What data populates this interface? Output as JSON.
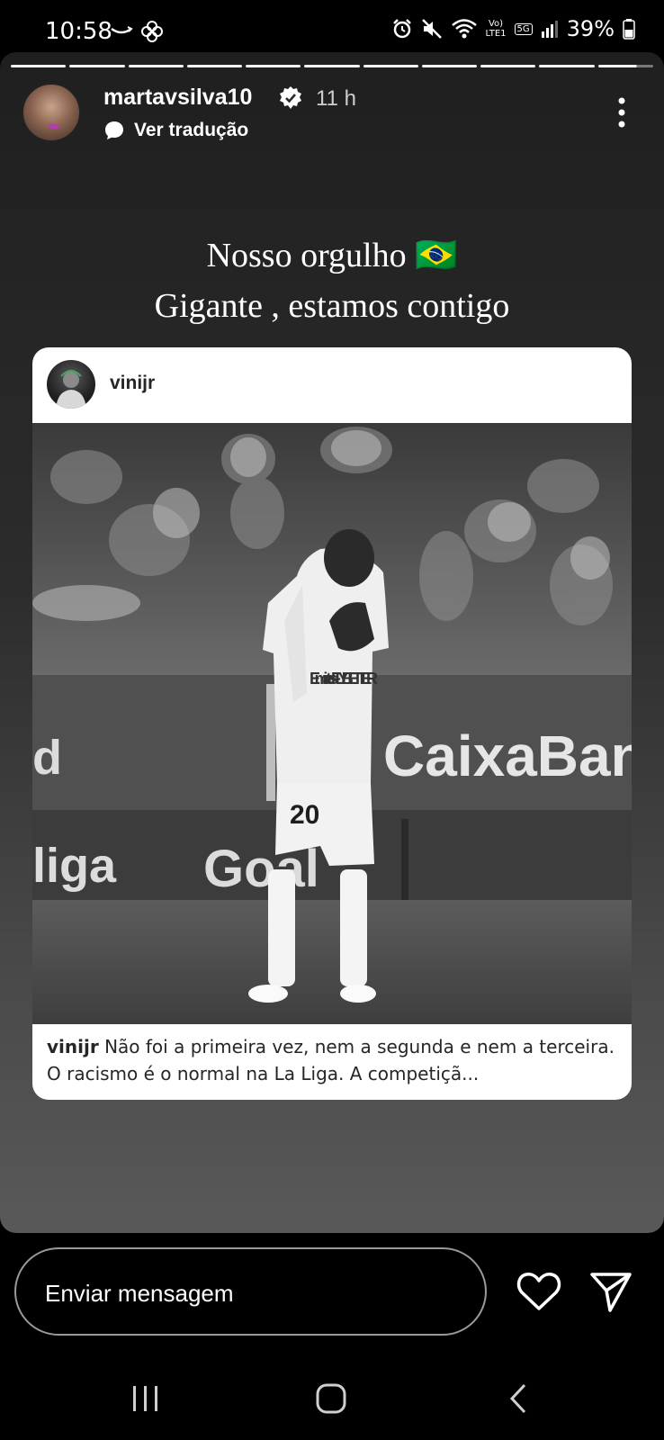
{
  "status_bar": {
    "time": "10:58",
    "network_top": "Vo)",
    "network_bottom": "LTE1",
    "net_5g": "5G",
    "battery": "39%"
  },
  "story": {
    "segments_total": 11,
    "username": "martavsilva10",
    "time_ago": "11 h",
    "translate_label": "Ver tradução",
    "headline_line1": "Nosso orgulho 🇧🇷",
    "headline_line2": "Gigante , estamos contigo"
  },
  "shared_post": {
    "username": "vinijr",
    "caption_user": "vinijr",
    "caption_text": " Não foi a primeira vez, nem a segunda e nem a terceira. O racismo é o normal na La Liga.  A competiçã...",
    "photo_texts": {
      "sponsor": "CaixaBank",
      "shirt_sponsor": "Emirates FLY BETTER",
      "number": "20",
      "board_left": "liga",
      "board_mid": "Goal"
    }
  },
  "reply_bar": {
    "placeholder": "Enviar mensagem"
  },
  "icons": [
    "silent-icon",
    "alarm-icon",
    "mute-icon",
    "wifi-icon",
    "signal-icon",
    "battery-icon",
    "verified-icon",
    "translate-icon",
    "more-icon",
    "heart-icon",
    "send-icon",
    "recent-apps-icon",
    "home-icon",
    "back-icon"
  ]
}
